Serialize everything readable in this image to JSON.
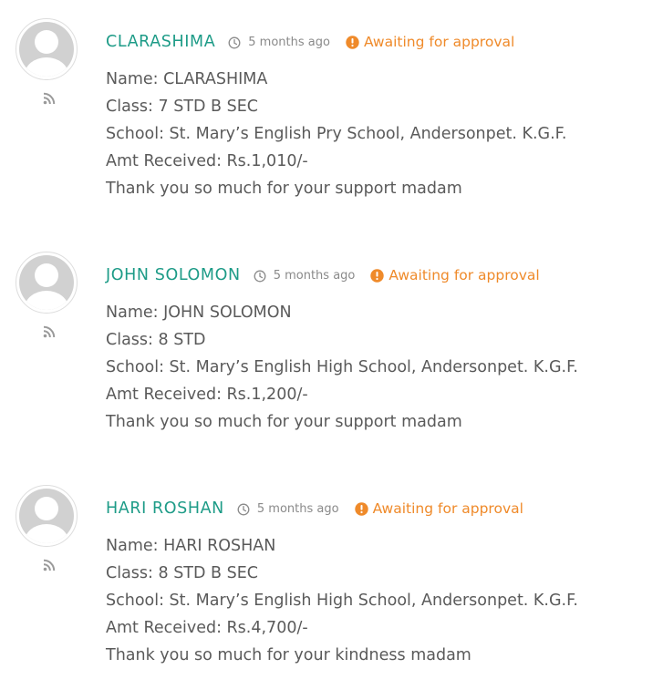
{
  "comments": [
    {
      "author": "CLARASHIMA",
      "time": "5 months ago",
      "status": "Awaiting for approval",
      "lines": [
        "Name: CLARASHIMA",
        "Class: 7 STD B SEC",
        "School: St. Mary’s English Pry School, Andersonpet. K.G.F.",
        "Amt Received: Rs.1,010/-",
        "Thank you so much for your support madam"
      ]
    },
    {
      "author": "JOHN SOLOMON",
      "time": "5 months ago",
      "status": "Awaiting for approval",
      "lines": [
        "Name: JOHN SOLOMON",
        "Class: 8 STD",
        "School: St. Mary’s English High School, Andersonpet. K.G.F.",
        "Amt Received: Rs.1,200/-",
        "Thank you so much for your support madam"
      ]
    },
    {
      "author": "HARI ROSHAN",
      "time": "5 months ago",
      "status": "Awaiting for approval",
      "lines": [
        "Name: HARI ROSHAN",
        "Class: 8 STD B SEC",
        "School: St. Mary’s English High School, Andersonpet. K.G.F.",
        "Amt Received: Rs.4,700/-",
        "Thank you so much for your kindness madam"
      ]
    }
  ],
  "colors": {
    "author": "#1d9b87",
    "status": "#ef8a2a",
    "time": "#8a8a8a",
    "text": "#5a5a5a",
    "avatar": "#d1d1d1"
  },
  "icons": {
    "avatar": "default-user-avatar",
    "feed": "rss-feed-icon",
    "time": "clock-icon",
    "status": "exclamation-circle-icon"
  }
}
